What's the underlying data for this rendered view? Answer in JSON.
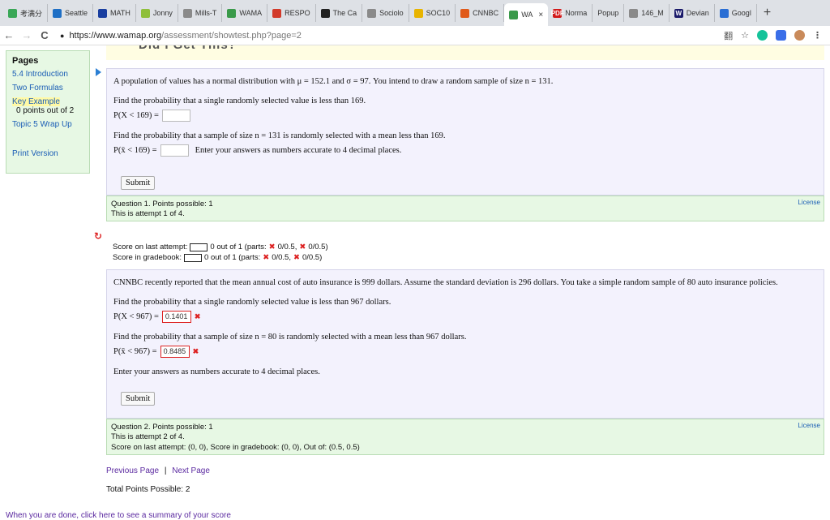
{
  "tabs": [
    {
      "label": "考满分",
      "color": "#3aa757"
    },
    {
      "label": "Seattle",
      "color": "#1f6fc5"
    },
    {
      "label": "MATH",
      "color": "#1a3fa0"
    },
    {
      "label": "Jonny",
      "color": "#8fbf3a"
    },
    {
      "label": "Mills-T",
      "color": "#8a8a8a"
    },
    {
      "label": "WAMA",
      "color": "#3a9a4a"
    },
    {
      "label": "RESPO",
      "color": "#d23a2a"
    },
    {
      "label": "The Ca",
      "color": "#222222"
    },
    {
      "label": "Sociolo",
      "color": "#8a8a8a"
    },
    {
      "label": "SOC10",
      "color": "#e8b400"
    },
    {
      "label": "CNNBC",
      "color": "#e05a1a"
    },
    {
      "label": "WA",
      "color": "#3a9a4a",
      "active": true
    },
    {
      "label": "Norma",
      "color": "#d21a1a",
      "badge": "PDF"
    },
    {
      "label": "Popup",
      "color": ""
    },
    {
      "label": "146_M",
      "color": "#8a8a8a"
    },
    {
      "label": "Devian",
      "color": "#1a1a6a",
      "badge": "W"
    },
    {
      "label": "Googl",
      "color": "#2a6ed4"
    }
  ],
  "tab_close": "×",
  "new_tab": "+",
  "nav": {
    "back": "←",
    "forward": "→",
    "reload": "C"
  },
  "url": {
    "host": "https://www.wamap.org",
    "path": "/assessment/showtest.php?page=2"
  },
  "toolbar_icons": {
    "translate": "翻",
    "star": "☆",
    "menu": "⋮"
  },
  "sidebar": {
    "title": "Pages",
    "items": [
      "5.4 Introduction",
      "Two Formulas",
      "Key Example",
      "Topic 5 Wrap Up"
    ],
    "points": "0 points out of 2",
    "print": "Print Version"
  },
  "top_cut_text": "Did I Get This?",
  "q1": {
    "intro": "A population of values has a normal distribution with μ = 152.1 and σ = 97. You intend to draw a random sample of size n = 131.",
    "part1": "Find the probability that a single randomly selected value is less than 169.",
    "part1_expr": "P(X < 169) =",
    "part2": "Find the probability that a sample of size n = 131 is randomly selected with a mean less than 169.",
    "part2_expr": "P(x̄ < 169) =",
    "note": "Enter your answers as numbers accurate to 4 decimal places.",
    "submit": "Submit",
    "info1": "Question 1. Points possible: 1",
    "info2": "This is attempt 1 of 4.",
    "license": "License"
  },
  "scores": {
    "last_label": "Score on last attempt:",
    "last_rest": "0 out of 1 (parts:",
    "grade_label": "Score in gradebook:",
    "grade_rest": "0 out of 1 (parts:",
    "part_a": "0/0.5,",
    "part_b": "0/0.5)",
    "x": "✖"
  },
  "q2": {
    "intro": "CNNBC recently reported that the mean annual cost of auto insurance is 999 dollars. Assume the standard deviation is 296 dollars. You take a simple random sample of 80 auto insurance policies.",
    "part1": "Find the probability that a single randomly selected value is less than 967 dollars.",
    "part1_expr": "P(X < 967) =",
    "ans1": "0.1401",
    "part2": "Find the probability that a sample of size n = 80 is randomly selected with a mean less than 967 dollars.",
    "part2_expr": "P(x̄ < 967) =",
    "ans2": "0.8485",
    "note": "Enter your answers as numbers accurate to 4 decimal places.",
    "submit": "Submit",
    "info1": "Question 2. Points possible: 1",
    "info2": "This is attempt 2 of 4.",
    "info3": "Score on last attempt: (0, 0), Score in gradebook: (0, 0), Out of: (0.5, 0.5)",
    "license": "License",
    "wrong_mark": "✖"
  },
  "pager": {
    "prev": "Previous Page",
    "sep": "|",
    "next": "Next Page"
  },
  "total": "Total Points Possible: 2",
  "done": "When you are done, click here to see a summary of your score"
}
